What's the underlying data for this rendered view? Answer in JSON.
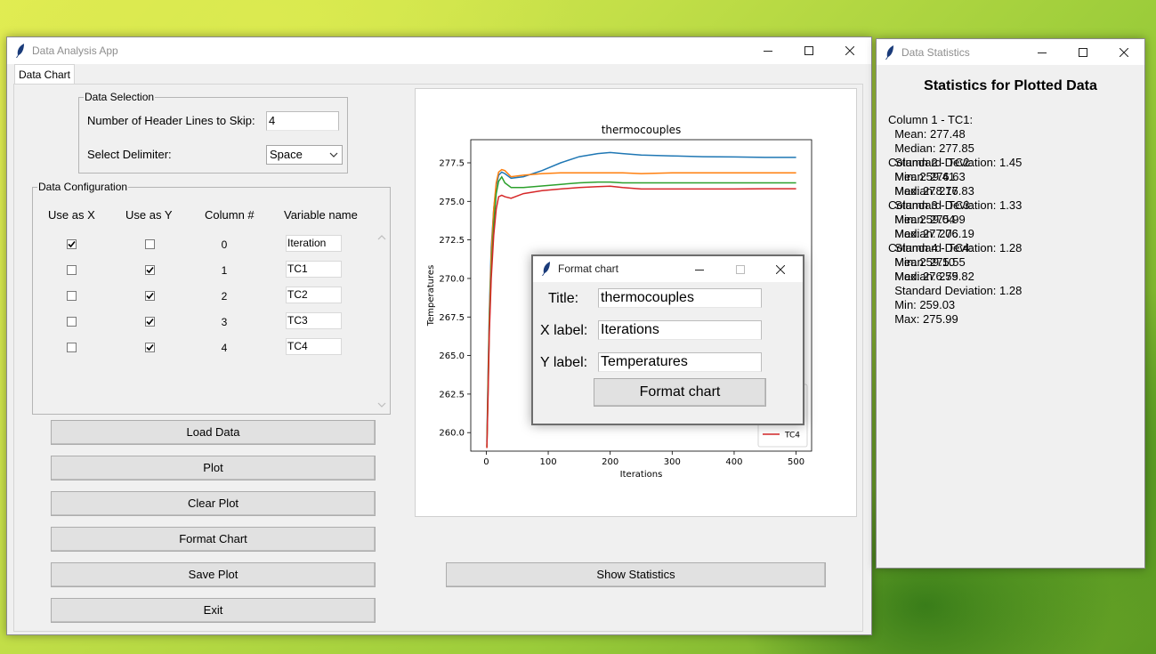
{
  "main_window": {
    "title": "Data Analysis App",
    "tab_label": "Data Chart",
    "data_selection": {
      "legend": "Data Selection",
      "header_lines_label": "Number of Header Lines to Skip:",
      "header_lines_value": "4",
      "delimiter_label": "Select Delimiter:",
      "delimiter_value": "Space"
    },
    "data_config": {
      "legend": "Data Configuration",
      "headers": [
        "Use as X",
        "Use as Y",
        "Column #",
        "Variable name"
      ],
      "rows": [
        {
          "use_x": true,
          "use_y": false,
          "column": "0",
          "name": "Iteration"
        },
        {
          "use_x": false,
          "use_y": true,
          "column": "1",
          "name": "TC1"
        },
        {
          "use_x": false,
          "use_y": true,
          "column": "2",
          "name": "TC2"
        },
        {
          "use_x": false,
          "use_y": true,
          "column": "3",
          "name": "TC3"
        },
        {
          "use_x": false,
          "use_y": true,
          "column": "4",
          "name": "TC4"
        }
      ]
    },
    "buttons": {
      "load": "Load Data",
      "plot": "Plot",
      "clear": "Clear Plot",
      "format": "Format Chart",
      "save": "Save Plot",
      "exit": "Exit",
      "show_stats": "Show Statistics"
    }
  },
  "chart_data": {
    "type": "line",
    "title": "thermocouples",
    "xlabel": "Iterations",
    "ylabel": "Temperatures",
    "xlim": [
      -25,
      525
    ],
    "ylim": [
      258.8,
      279.0
    ],
    "xticks": [
      0,
      100,
      200,
      300,
      400,
      500
    ],
    "yticks": [
      260.0,
      262.5,
      265.0,
      267.5,
      270.0,
      272.5,
      275.0,
      277.5
    ],
    "legend_position": "lower right",
    "series": [
      {
        "name": "TC1",
        "color": "#1f77b4",
        "x": [
          1,
          3,
          5,
          8,
          12,
          16,
          20,
          25,
          30,
          40,
          60,
          90,
          120,
          150,
          180,
          200,
          220,
          250,
          300,
          350,
          400,
          450,
          500
        ],
        "y": [
          259.4,
          264.0,
          268.0,
          272.0,
          274.5,
          276.0,
          276.7,
          276.9,
          276.8,
          276.5,
          276.6,
          277.0,
          277.5,
          277.9,
          278.1,
          278.17,
          278.1,
          278.0,
          277.95,
          277.9,
          277.88,
          277.85,
          277.85
        ]
      },
      {
        "name": "TC2",
        "color": "#ff7f0e",
        "x": [
          1,
          3,
          5,
          8,
          12,
          16,
          20,
          25,
          30,
          40,
          60,
          90,
          120,
          150,
          180,
          200,
          220,
          250,
          300,
          350,
          400,
          450,
          500
        ],
        "y": [
          259.0,
          263.5,
          267.5,
          271.5,
          274.5,
          276.2,
          276.9,
          277.06,
          277.0,
          276.6,
          276.7,
          276.8,
          276.85,
          276.85,
          276.85,
          276.85,
          276.85,
          276.8,
          276.85,
          276.85,
          276.85,
          276.85,
          276.85
        ]
      },
      {
        "name": "TC3",
        "color": "#2ca02c",
        "x": [
          1,
          3,
          5,
          8,
          12,
          16,
          20,
          25,
          30,
          40,
          60,
          90,
          120,
          150,
          180,
          200,
          220,
          250,
          300,
          350,
          400,
          450,
          500
        ],
        "y": [
          259.1,
          263.0,
          267.0,
          270.5,
          273.5,
          275.5,
          276.3,
          276.59,
          276.2,
          275.9,
          275.9,
          276.0,
          276.1,
          276.2,
          276.25,
          276.25,
          276.2,
          276.2,
          276.2,
          276.2,
          276.2,
          276.2,
          276.2
        ]
      },
      {
        "name": "TC4",
        "color": "#d62728",
        "x": [
          1,
          3,
          5,
          8,
          12,
          16,
          20,
          25,
          30,
          40,
          60,
          90,
          120,
          150,
          180,
          200,
          220,
          250,
          300,
          350,
          400,
          450,
          500
        ],
        "y": [
          259.0,
          262.5,
          266.5,
          270.0,
          272.8,
          274.5,
          275.3,
          275.4,
          275.3,
          275.2,
          275.5,
          275.7,
          275.8,
          275.9,
          275.95,
          275.99,
          275.9,
          275.8,
          275.8,
          275.8,
          275.8,
          275.82,
          275.82
        ]
      }
    ]
  },
  "format_dialog": {
    "title": "Format chart",
    "title_label": "Title:",
    "title_value": "thermocouples",
    "xlabel_label": "X label:",
    "xlabel_value": "Iterations",
    "ylabel_label": "Y label:",
    "ylabel_value": "Temperatures",
    "button": "Format chart"
  },
  "stats_window": {
    "title": "Data Statistics",
    "heading": "Statistics for Plotted Data",
    "columns": [
      {
        "header": "Column 1 - TC1:",
        "lines": [
          "  Mean: 277.48",
          "  Median: 277.85",
          "  Standard Deviation: 1.45",
          "  Min: 259.41",
          "  Max: 278.17"
        ]
      },
      {
        "header": "Column 2 - TC2:",
        "lines": [
          "  Mean: 276.63",
          "  Median: 276.83",
          "  Standard Deviation: 1.33",
          "  Min: 259.04",
          "  Max: 277.06"
        ]
      },
      {
        "header": "Column 3 - TC3:",
        "lines": [
          "  Mean: 275.99",
          "  Median: 276.19",
          "  Standard Deviation: 1.28",
          "  Min: 259.10",
          "  Max: 276.59"
        ]
      },
      {
        "header": "Column 4 - TC4:",
        "lines": [
          "  Mean: 275.55",
          "  Median: 275.82",
          "  Standard Deviation: 1.28",
          "  Min: 259.03",
          "  Max: 275.99"
        ]
      }
    ]
  }
}
